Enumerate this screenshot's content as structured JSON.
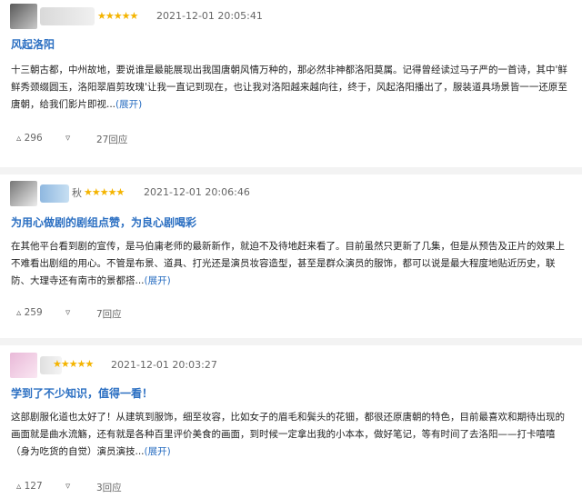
{
  "colors": {
    "star": "#f4b400",
    "link": "#2b6fc2",
    "meta": "#666666"
  },
  "reviews": [
    {
      "stars": "★★★★★",
      "date": "2021-12-01 20:05:41",
      "headline": "风起洛阳",
      "body": "十三朝古都，中州故地，要说谁是最能展现出我国唐朝风情万种的，那必然非神都洛阳莫属。记得曾经读过马子严的一首诗，其中'鲜鲜秀颈缀圆玉，洛阳翠眉剪玫瑰'让我一直记到现在，也让我对洛阳越来越向往，终于，风起洛阳播出了，服装道具场景皆一一还原至唐朝，给我们影片即视...",
      "expand": "(展开)",
      "likes": "296",
      "replies": "27回应"
    },
    {
      "user_suffix": "秋",
      "stars": "★★★★★",
      "date": "2021-12-01 20:06:46",
      "headline": "为用心做剧的剧组点赞，为良心剧喝彩",
      "body": "在其他平台看到剧的宣传，是马伯庸老师的最新新作，就迫不及待地赶来看了。目前虽然只更新了几集，但是从预告及正片的效果上不难看出剧组的用心。不管是布景、道具、打光还是演员妆容造型，甚至是群众演员的服饰，都可以说是最大程度地贴近历史，联防、大理寺还有南市的景都搭...",
      "expand": "(展开)",
      "likes": "259",
      "replies": "7回应"
    },
    {
      "stars": "★★★★★",
      "date": "2021-12-01 20:03:27",
      "headline": "学到了不少知识，值得一看！",
      "body": "这部剧服化道也太好了！从建筑到服饰，细至妆容，比如女子的眉毛和鬓头的花钿，都很还原唐朝的特色，目前最喜欢和期待出现的画面就是曲水流觞，还有就是各种百里评价美食的画面，到时候一定拿出我的小本本，做好笔记，等有时间了去洛阳——打卡嘻嘻（身为吃货的自觉）演员演技...",
      "expand": "(展开)",
      "likes": "127",
      "replies": "3回应"
    }
  ]
}
